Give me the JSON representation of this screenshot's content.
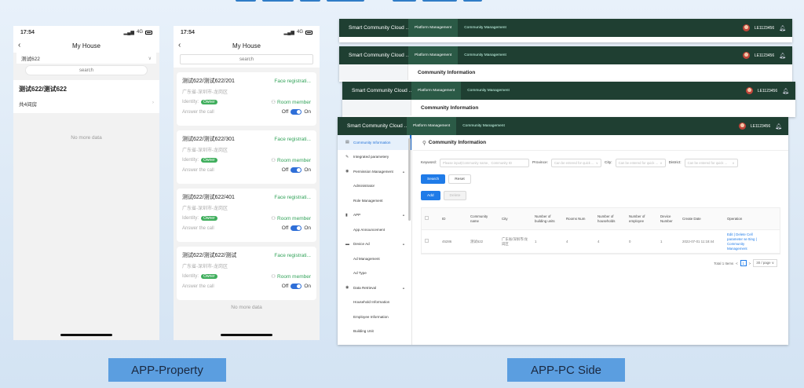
{
  "phone_property": {
    "time": "17:54",
    "signal": "4G",
    "title": "My House",
    "community": "测试622",
    "search_placeholder": "search",
    "house_name": "测试622/测试622",
    "house_count": "共4间房",
    "empty_text": "No more data"
  },
  "phone_units": {
    "time": "17:54",
    "signal": "4G",
    "title": "My House",
    "search_placeholder": "search",
    "identity_label": "Identity:",
    "owner_badge": "Owner",
    "room_member": "Room member",
    "answer_label": "Answer the call",
    "off_label": "Off",
    "on_label": "On",
    "cards": [
      {
        "name": "测试622/测试622/201",
        "status": "Face registrati...",
        "address": "广东省-深圳市-龙岗区"
      },
      {
        "name": "测试622/测试622/301",
        "status": "Face registrati...",
        "address": "广东省-深圳市-龙岗区"
      },
      {
        "name": "测试622/测试622/401",
        "status": "Face registrati...",
        "address": "广东省-深圳市-龙岗区"
      },
      {
        "name": "测试622/测试622/测试",
        "status": "Face registrati...",
        "address": "广东省-深圳市-龙岗区"
      }
    ],
    "empty_text": "No more data"
  },
  "pc": {
    "brand": "Smart Community Cloud ...",
    "tab_platform": "Platform Management",
    "tab_community": "Community Management",
    "user": "LE1123456",
    "page_title": "Community Information",
    "sidebar": [
      {
        "label": "Community Information",
        "icon": "▤",
        "active": true,
        "child": false
      },
      {
        "label": "Integrated parametery",
        "icon": "✎",
        "active": false,
        "child": false
      },
      {
        "label": "Permission Management",
        "icon": "◉",
        "active": false,
        "child": false,
        "caret": "▲"
      },
      {
        "label": "Administrator",
        "icon": "",
        "active": false,
        "child": true
      },
      {
        "label": "Role Management",
        "icon": "",
        "active": false,
        "child": true
      },
      {
        "label": "APP",
        "icon": "▮",
        "active": false,
        "child": false,
        "caret": "▲"
      },
      {
        "label": "App Announcement",
        "icon": "",
        "active": false,
        "child": true
      },
      {
        "label": "Device Ad",
        "icon": "▬",
        "active": false,
        "child": false,
        "caret": "▲"
      },
      {
        "label": "Ad Management",
        "icon": "",
        "active": false,
        "child": true
      },
      {
        "label": "Ad Type",
        "icon": "",
        "active": false,
        "child": true
      },
      {
        "label": "Data Retrieval",
        "icon": "◉",
        "active": false,
        "child": false,
        "caret": "▲"
      },
      {
        "label": "Household Information",
        "icon": "",
        "active": false,
        "child": true
      },
      {
        "label": "Employee Information",
        "icon": "",
        "active": false,
        "child": true
      },
      {
        "label": "Building Unit",
        "icon": "",
        "active": false,
        "child": true
      }
    ],
    "filters": {
      "keyword_label": "Keyword:",
      "keyword_placeholder": "Please input(Community name、Community ID",
      "province_label": "Province:",
      "province_placeholder": "Can be entered for quick ...",
      "city_label": "City:",
      "city_placeholder": "Can be entered for quick ...",
      "district_label": "District:",
      "district_placeholder": "Can be entered for quick ..."
    },
    "buttons": {
      "search": "Search",
      "reset": "Reset",
      "add": "Add",
      "delete": "Delete"
    },
    "table": {
      "headers": [
        "ID",
        "Community name",
        "City",
        "Number of building units",
        "Rooms Num",
        "Number of households",
        "Number of employee",
        "Device Number",
        "Create Date",
        "Operation"
      ],
      "row": [
        "45286",
        "测试622",
        "广东省/深圳市/龙岗区",
        "1",
        "4",
        "4",
        "0",
        "1",
        "2022-07-01 11:18:44"
      ],
      "operations": "Edit | Delete  Cell parameter se tting | Community Management"
    },
    "pager": {
      "total": "Total 1 Items",
      "prev": "<",
      "page": "1",
      "next": ">",
      "size": "30 / page"
    }
  },
  "captions": {
    "left": "APP-Property",
    "right": "APP-PC Side"
  }
}
